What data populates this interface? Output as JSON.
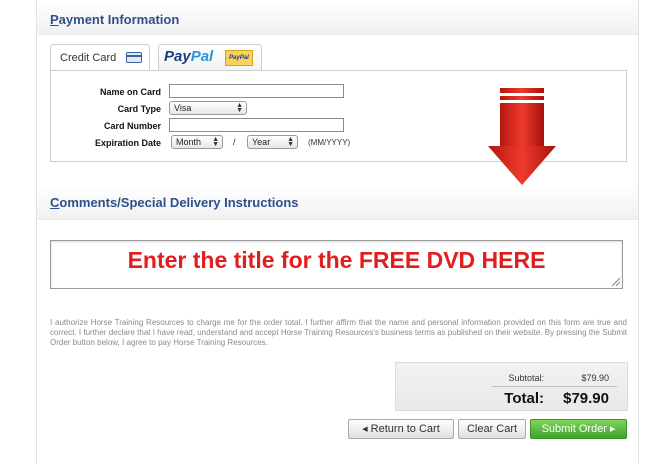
{
  "payment_section": {
    "title_first": "P",
    "title_rest": "ayment Information"
  },
  "tabs": [
    {
      "label": "Credit Card",
      "icon": "credit-card-icon"
    },
    {
      "label_pay": "Pay",
      "label_pal": "Pal",
      "badge": "PayPal"
    }
  ],
  "form": {
    "name_label": "Name on Card",
    "type_label": "Card Type",
    "type_value": "Visa",
    "number_label": "Card Number",
    "exp_label": "Expiration Date",
    "month_value": "Month",
    "slash": "/",
    "year_value": "Year",
    "format_hint": "(MM/YYYY)"
  },
  "comments_section": {
    "title_first": "C",
    "title_rest": "omments/Special Delivery Instructions",
    "text": "Enter the title for the FREE DVD HERE"
  },
  "legal_text": "I authorize Horse Training Resources to charge me for the order total. I further affirm that the name and personal information provided on this form are true and correct. I further declare that I have read, understand and accept Horse Training Resources's business terms as published on their website. By pressing the Submit Order button below, I agree to pay Horse Training Resources.",
  "totals": {
    "subtotal_label": "Subtotal:",
    "subtotal_value": "$79.90",
    "total_label": "Total:",
    "total_value": "$79.90"
  },
  "buttons": {
    "return_label": "Return to Cart",
    "clear_label": "Clear Cart",
    "submit_label": "Submit Order"
  },
  "colors": {
    "accent": "#2e4f8c",
    "arrow": "#d9261c",
    "callout_text": "#e21d1d",
    "submit": "#3fa22a"
  }
}
